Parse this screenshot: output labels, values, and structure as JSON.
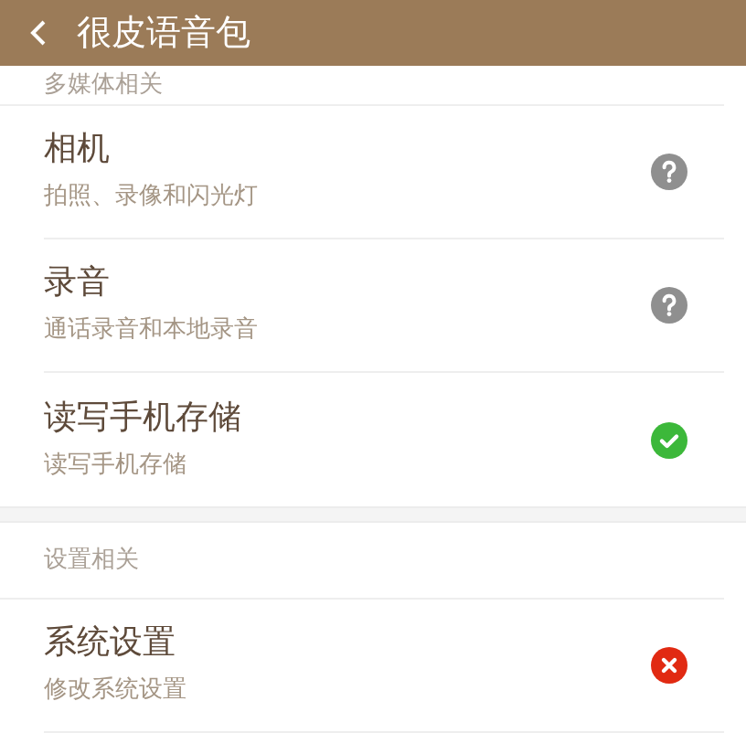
{
  "header": {
    "title": "很皮语音包"
  },
  "sections": [
    {
      "label": "多媒体相关",
      "items": [
        {
          "title": "相机",
          "subtitle": "拍照、录像和闪光灯",
          "kind": "unknown"
        },
        {
          "title": "录音",
          "subtitle": "通话录音和本地录音",
          "kind": "unknown"
        },
        {
          "title": "读写手机存储",
          "subtitle": "读写手机存储",
          "kind": "granted"
        }
      ]
    },
    {
      "label": "设置相关",
      "items": [
        {
          "title": "系统设置",
          "subtitle": "修改系统设置",
          "kind": "denied"
        }
      ]
    }
  ]
}
